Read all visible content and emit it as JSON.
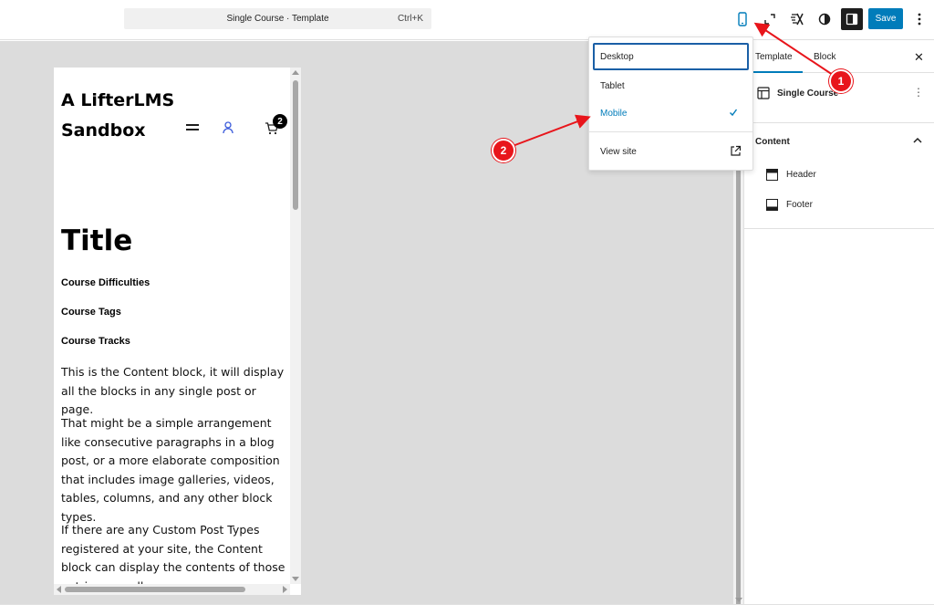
{
  "topbar": {
    "command_title": "Single Course · Template",
    "command_shortcut": "Ctrl+K",
    "save_label": "Save",
    "icons": [
      "mobile-device-icon",
      "zoom-out-icon",
      "styles-icon",
      "contrast-icon",
      "sidebar-toggle-icon",
      "more-vertical-icon"
    ]
  },
  "preview": {
    "site_title": "A LifterLMS Sandbox",
    "cart_count": "2",
    "post_title": "Title",
    "meta": [
      "Course Difficulties",
      "Course Tags",
      "Course Tracks"
    ],
    "paragraphs": [
      "This is the Content block, it will display all the blocks in any single post or page.",
      "That might be a simple arrangement like consecutive paragraphs in a blog post, or a more elaborate composition that includes image galleries, videos, tables, columns, and any other block types.",
      "If there are any Custom Post Types registered at your site, the Content block can display the contents of those entries as well."
    ]
  },
  "sidebar": {
    "tabs": [
      "Template",
      "Block"
    ],
    "active_tab": "Template",
    "template_name": "Single Course",
    "content_heading": "Content",
    "items": [
      "Header",
      "Footer"
    ]
  },
  "dropdown": {
    "items": [
      "Desktop",
      "Tablet",
      "Mobile"
    ],
    "focused": "Desktop",
    "selected": "Mobile",
    "view_site": "View site"
  },
  "annotations": [
    "1",
    "2"
  ],
  "colors": {
    "accent": "#007cba",
    "annotation": "#e8151b",
    "canvas": "#dcdcdc"
  }
}
